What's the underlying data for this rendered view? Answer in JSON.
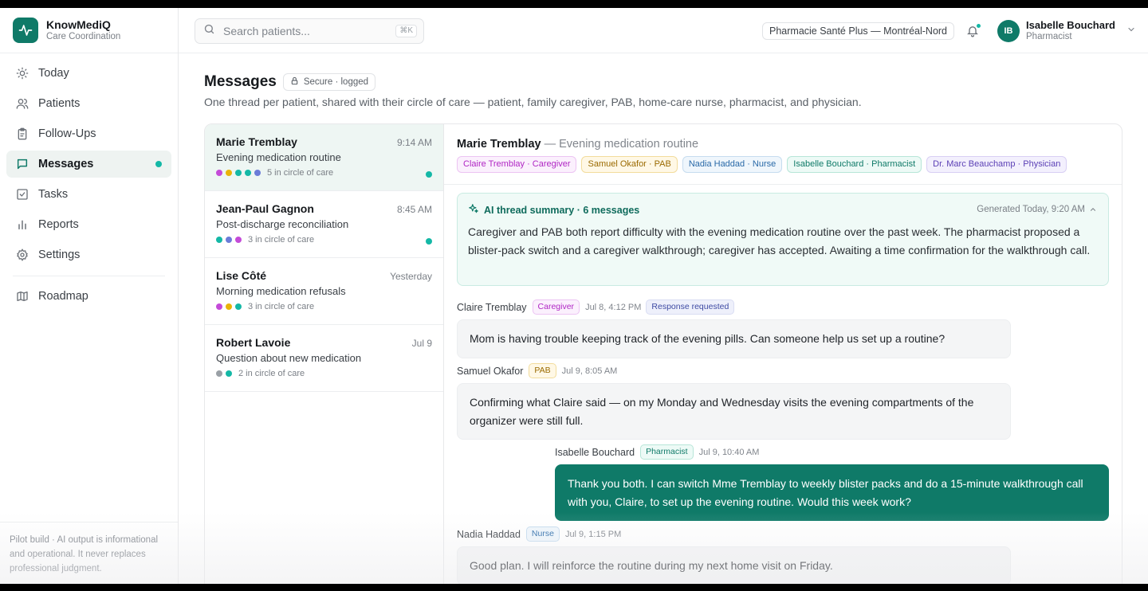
{
  "brand": {
    "name": "KnowMediQ",
    "subtitle": "Care Coordination"
  },
  "nav": {
    "items": [
      {
        "label": "Today",
        "icon": "sun-icon"
      },
      {
        "label": "Patients",
        "icon": "users-icon"
      },
      {
        "label": "Follow-Ups",
        "icon": "clipboard-icon"
      },
      {
        "label": "Messages",
        "icon": "message-square-icon",
        "active": true,
        "unread": true
      },
      {
        "label": "Tasks",
        "icon": "check-square-icon"
      },
      {
        "label": "Reports",
        "icon": "bar-chart-icon"
      },
      {
        "label": "Settings",
        "icon": "gear-icon"
      }
    ],
    "secondary": [
      {
        "label": "Roadmap",
        "icon": "map-icon"
      }
    ]
  },
  "sidebar_footer": "Pilot build · AI output is informational and operational. It never replaces professional judgment.",
  "search": {
    "placeholder": "Search patients...",
    "shortcut": "⌘K"
  },
  "pharmacy": "Pharmacie Santé Plus — Montréal-Nord",
  "user": {
    "initials": "IB",
    "name": "Isabelle Bouchard",
    "role": "Pharmacist"
  },
  "page": {
    "title": "Messages",
    "secure_badge": "Secure · logged",
    "subtitle": "One thread per patient, shared with their circle of care — patient, family caregiver, PAB, home-care nurse, pharmacist, and physician."
  },
  "threads": [
    {
      "name": "Marie Tremblay",
      "time": "9:14 AM",
      "subject": "Evening medication routine",
      "circle": "5 in circle of care",
      "dots": [
        "#c44bd8",
        "#eab308",
        "#14b8a6",
        "#14b8a6",
        "#6b7cd8"
      ],
      "unread": true,
      "active": true
    },
    {
      "name": "Jean-Paul Gagnon",
      "time": "8:45 AM",
      "subject": "Post-discharge reconciliation",
      "circle": "3 in circle of care",
      "dots": [
        "#14b8a6",
        "#6b7cd8",
        "#c44bd8"
      ],
      "unread": true,
      "active": false
    },
    {
      "name": "Lise Côté",
      "time": "Yesterday",
      "subject": "Morning medication refusals",
      "circle": "3 in circle of care",
      "dots": [
        "#c44bd8",
        "#eab308",
        "#14b8a6"
      ],
      "unread": false,
      "active": false
    },
    {
      "name": "Robert Lavoie",
      "time": "Jul 9",
      "subject": "Question about new medication",
      "circle": "2 in circle of care",
      "dots": [
        "#9aa0a6",
        "#14b8a6"
      ],
      "unread": false,
      "active": false
    }
  ],
  "conversation": {
    "patient": "Marie Tremblay",
    "subject": "— Evening medication routine",
    "participants": [
      {
        "label": "Claire Tremblay · Caregiver",
        "color": "#b026c4",
        "bg": "#fbf0fd",
        "border": "#ecc4f3"
      },
      {
        "label": "Samuel Okafor · PAB",
        "color": "#9a6a00",
        "bg": "#fff8e6",
        "border": "#f2dc9c"
      },
      {
        "label": "Nadia Haddad · Nurse",
        "color": "#2a6aa8",
        "bg": "#eff6fc",
        "border": "#c6dcef"
      },
      {
        "label": "Isabelle Bouchard · Pharmacist",
        "color": "#0f7a68",
        "bg": "#edfaf6",
        "border": "#b7e6d8"
      },
      {
        "label": "Dr. Marc Beauchamp · Physician",
        "color": "#5b3fb5",
        "bg": "#f3f0fd",
        "border": "#d8cff4"
      }
    ],
    "summary": {
      "title": "AI thread summary · 6 messages",
      "generated": "Generated Today, 9:20 AM",
      "text": "Caregiver and PAB both report difficulty with the evening medication routine over the past week. The pharmacist proposed a blister-pack switch and a caregiver walkthrough; caregiver has accepted. Awaiting a time confirmation for the walkthrough call."
    },
    "messages": [
      {
        "author": "Claire Tremblay",
        "role": "Caregiver",
        "time": "Jul 8, 4:12 PM",
        "flag": "Response requested",
        "text": "Mom is having trouble keeping track of the evening pills. Can someone help us set up a routine?"
      },
      {
        "author": "Samuel Okafor",
        "role": "PAB",
        "time": "Jul 9, 8:05 AM",
        "text": "Confirming what Claire said — on my Monday and Wednesday visits the evening compartments of the organizer were still full."
      },
      {
        "author": "Isabelle Bouchard",
        "role": "Pharmacist",
        "time": "Jul 9, 10:40 AM",
        "text": "Thank you both. I can switch Mme Tremblay to weekly blister packs and do a 15-minute walkthrough call with you, Claire, to set up the evening routine. Would this week work?"
      },
      {
        "author": "Nadia Haddad",
        "role": "Nurse",
        "time": "Jul 9, 1:15 PM",
        "text": "Good plan. I will reinforce the routine during my next home visit on Friday."
      }
    ]
  },
  "colors": {
    "accent": "#0f7a68",
    "unread_dot": "#14b8a6"
  }
}
